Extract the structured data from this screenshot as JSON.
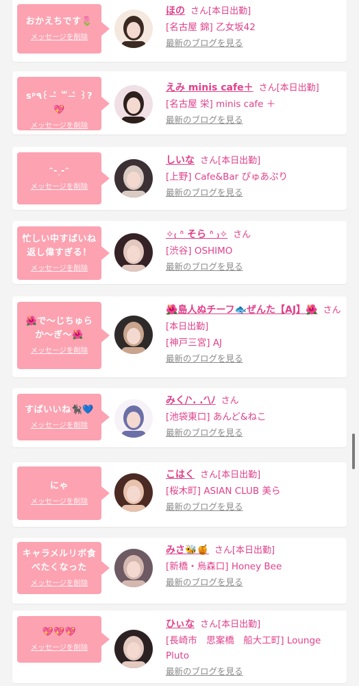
{
  "delete_label": "メッセージを削除",
  "blog_label": "最新のブログを見る",
  "honorific": "さん",
  "on_duty": "[本日出勤]",
  "colors": {
    "accent": "#e0408a",
    "bubble": "#fca2b1"
  },
  "items": [
    {
      "message": "おかえちです🌷",
      "name": "ほの",
      "on_duty": true,
      "shop": "[名古屋 錦] 乙女坂42",
      "avatar": "girl-avatar"
    },
    {
      "message": "ꜱᵖ٩꒰ ˃̶ ꒳ ˂̶ ꒱?💖",
      "name": "えみ minis cafe＋",
      "on_duty": true,
      "shop": "[名古屋 栄] minis cafe ＋",
      "avatar": "girl-avatar"
    },
    {
      "message": "ᵔ-˰-ᵔ",
      "name": "しいな",
      "on_duty": true,
      "shop": "[上野] Cafe&Bar ぴゅあぷり",
      "avatar": "girl-avatar"
    },
    {
      "message": "忙しい中すばいね返し偉すぎる！",
      "name": "✧₍ ᐢ そら ᐢ ₎✧",
      "on_duty": false,
      "shop": "[渋谷] OSHIMO",
      "avatar": "girl-avatar"
    },
    {
      "message": "🌺で〜じちゅらか〜ぎ〜🌺",
      "name": "🌺島人ぬチーフ🐟ぜんた【AJ】🌺",
      "on_duty": true,
      "shop": "[神戸三宮] AJ",
      "avatar": "man-avatar"
    },
    {
      "message": "すばいいね🐈‍⬛💙",
      "name": "みく/ᐠ. .ᐟ\\ﾉ",
      "on_duty": false,
      "shop": "[池袋東口] あんど&ねこ",
      "avatar": "illustration-avatar"
    },
    {
      "message": "にゃ",
      "name": "こはく",
      "on_duty": true,
      "shop": "[桜木町] ASIAN CLUB 美ら",
      "avatar": "girl-avatar"
    },
    {
      "message": "キャラメルリボ食べたくなった",
      "name": "みさ🐝🍯",
      "on_duty": true,
      "shop": "[新橋・烏森口] Honey Bee",
      "avatar": "girl-avatar"
    },
    {
      "message": "💖💖💖",
      "name": "ひぃな",
      "on_duty": true,
      "shop": "[長崎市　思案橋　船大工町] Lounge Pluto",
      "avatar": "girl-avatar"
    }
  ]
}
